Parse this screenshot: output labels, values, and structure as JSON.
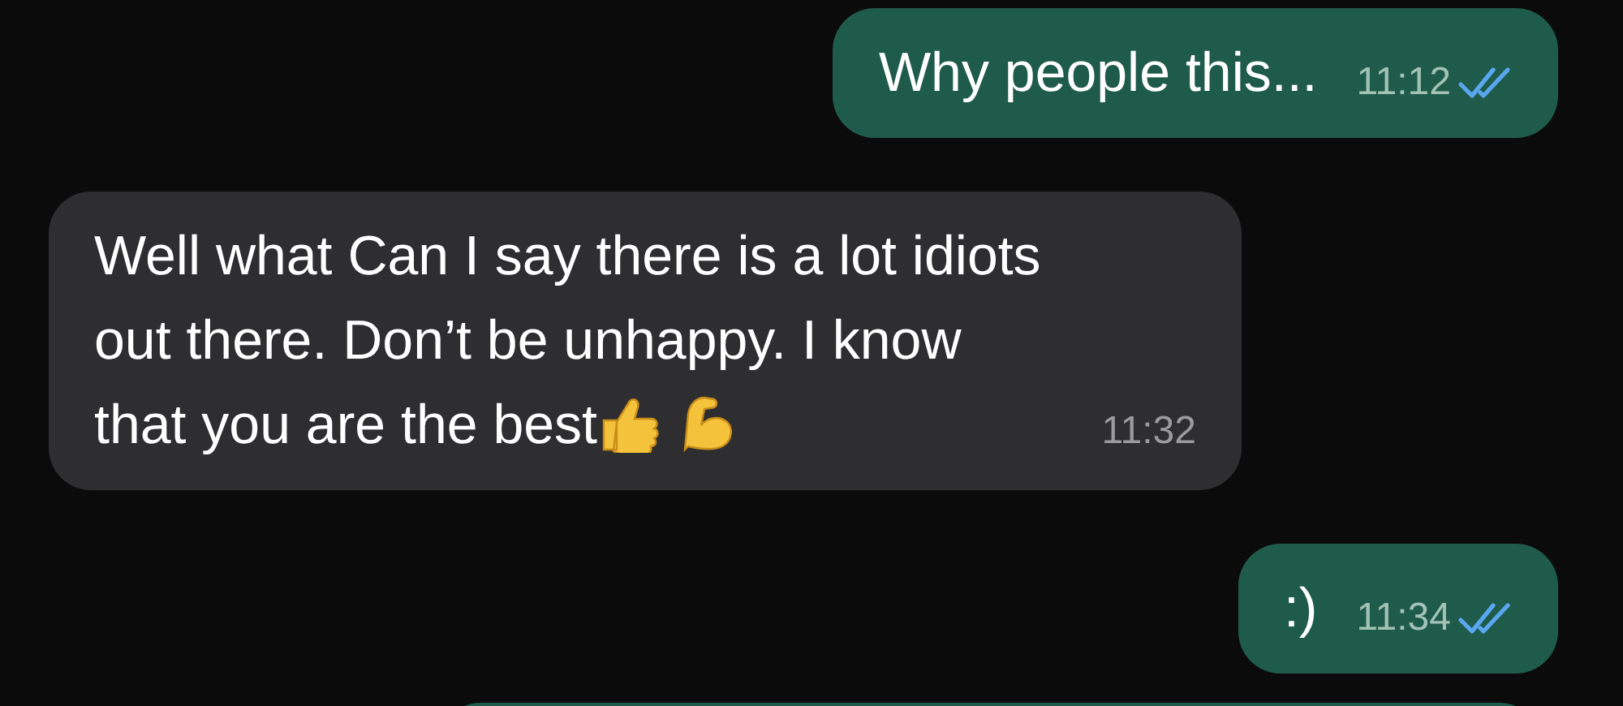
{
  "messages": [
    {
      "kind": "outgoing",
      "text": "Why people this...",
      "time": "11:12",
      "read": true
    },
    {
      "kind": "incoming",
      "text": "Well what Can I say there is a lot idiots out there. Don’t be unhappy. I know that you are the best",
      "time": "11:32",
      "emojis": [
        {
          "kind": "thumbs-up"
        },
        {
          "kind": "flexed-arm"
        }
      ]
    },
    {
      "kind": "outgoing",
      "text": ":)",
      "time": "11:34",
      "read": true
    }
  ]
}
